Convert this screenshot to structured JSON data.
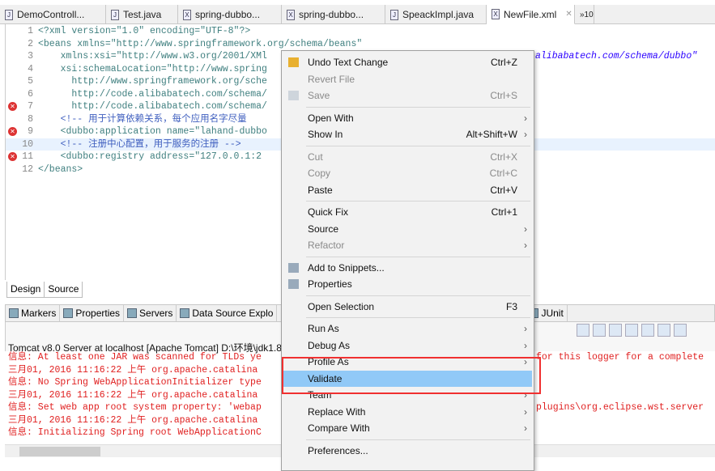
{
  "tabs": [
    {
      "label": "DemoControll...",
      "icon": "java-file-icon"
    },
    {
      "label": "Test.java",
      "icon": "java-file-icon"
    },
    {
      "label": "spring-dubbo...",
      "icon": "xml-file-icon"
    },
    {
      "label": "spring-dubbo...",
      "icon": "xml-file-icon"
    },
    {
      "label": "SpeackImpl.java",
      "icon": "java-file-icon"
    },
    {
      "label": "NewFile.xml",
      "icon": "xml-file-icon",
      "active": true
    }
  ],
  "tabs_overflow": "»10",
  "editor": {
    "lines": [
      {
        "n": "1",
        "code": "<?xml version=\"1.0\" encoding=\"UTF-8\"?>"
      },
      {
        "n": "2",
        "code": "<beans xmlns=\"http://www.springframework.org/schema/beans\""
      },
      {
        "n": "3",
        "code": "    xmlns:xsi=\"http://www.w3.org/2001/XMl",
        "right": "alibabatech.com/schema/dubbo\""
      },
      {
        "n": "4",
        "code": "    xsi:schemaLocation=\"http://www.spring"
      },
      {
        "n": "5",
        "code": "      http://www.springframework.org/sche"
      },
      {
        "n": "6",
        "code": "      http://code.alibabatech.com/schema/"
      },
      {
        "n": "7",
        "code": "      http://code.alibabatech.com/schema/",
        "error": true
      },
      {
        "n": "8",
        "code": "    <!-- 用于计算依赖关系，每个应用名字尽量"
      },
      {
        "n": "9",
        "code": "    <dubbo:application name=\"lahand-dubbo",
        "error": true
      },
      {
        "n": "10",
        "code": "    <!-- 注册中心配置，用于服务的注册 -->",
        "highlight": true
      },
      {
        "n": "11",
        "code": "    <dubbo:registry address=\"127.0.0.1:2",
        "error": true
      },
      {
        "n": "12",
        "code": "</beans>"
      }
    ]
  },
  "editor_tabs": [
    "Design",
    "Source"
  ],
  "views": [
    "Markers",
    "Properties",
    "Servers",
    "Data Source Explo",
    "JUnit"
  ],
  "console": {
    "title": "Tomcat v8.0 Server at localhost [Apache Tomcat] D:\\环境\\jdk1.8",
    "lines": [
      "信息: At least one JAR was scanned for TLDs ye",
      "三月01, 2016 11:16:22 上午 org.apache.catalina",
      "信息: No Spring WebApplicationInitializer type",
      "三月01, 2016 11:16:22 上午 org.apache.catalina",
      "信息: Set web app root system property: 'webap",
      "三月01, 2016 11:16:22 上午 org.apache.catalina",
      "信息: Initializing Spring root WebApplicationC"
    ],
    "right_lines": [
      "for this logger for a complete",
      "",
      "",
      "",
      "plugins\\org.eclipse.wst.server",
      "",
      ""
    ]
  },
  "context_menu": {
    "items": [
      {
        "label": "Undo Text Change",
        "shortcut": "Ctrl+Z",
        "icon": "undo-icon"
      },
      {
        "label": "Revert File",
        "disabled": true
      },
      {
        "label": "Save",
        "shortcut": "Ctrl+S",
        "disabled": true,
        "icon": "save-icon"
      },
      {
        "sep": true
      },
      {
        "label": "Open With",
        "submenu": true
      },
      {
        "label": "Show In",
        "shortcut": "Alt+Shift+W",
        "submenu": true
      },
      {
        "sep": true
      },
      {
        "label": "Cut",
        "shortcut": "Ctrl+X",
        "disabled": true
      },
      {
        "label": "Copy",
        "shortcut": "Ctrl+C",
        "disabled": true
      },
      {
        "label": "Paste",
        "shortcut": "Ctrl+V"
      },
      {
        "sep": true
      },
      {
        "label": "Quick Fix",
        "shortcut": "Ctrl+1"
      },
      {
        "label": "Source",
        "submenu": true
      },
      {
        "label": "Refactor",
        "submenu": true,
        "disabled": true
      },
      {
        "sep": true
      },
      {
        "label": "Add to Snippets...",
        "icon": "snippets-icon"
      },
      {
        "label": "Properties",
        "icon": "properties-icon"
      },
      {
        "sep": true
      },
      {
        "label": "Open Selection",
        "shortcut": "F3"
      },
      {
        "sep": true
      },
      {
        "label": "Run As",
        "submenu": true
      },
      {
        "label": "Debug As",
        "submenu": true
      },
      {
        "label": "Profile As",
        "submenu": true
      },
      {
        "label": "Validate",
        "selected": true
      },
      {
        "label": "Team",
        "submenu": true
      },
      {
        "label": "Replace With",
        "submenu": true
      },
      {
        "label": "Compare With",
        "submenu": true
      },
      {
        "sep": true
      },
      {
        "label": "Preferences..."
      }
    ]
  }
}
